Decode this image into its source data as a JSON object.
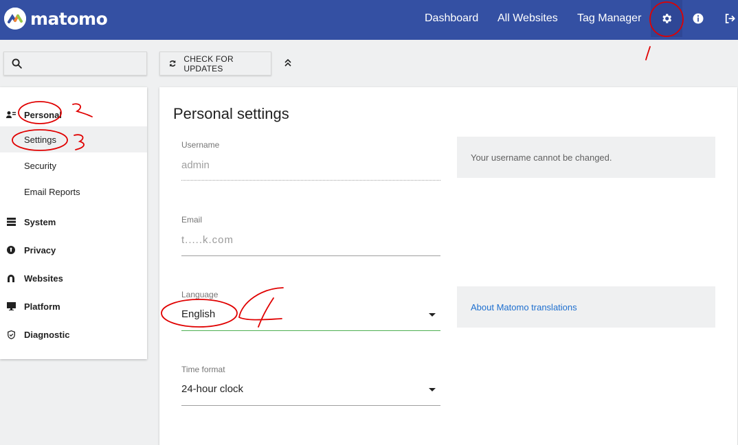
{
  "brand": {
    "name": "matomo"
  },
  "topnav": {
    "dashboard": "Dashboard",
    "all_websites": "All Websites",
    "tag_manager": "Tag Manager",
    "icons": [
      "gear-icon",
      "info-icon",
      "logout-icon"
    ]
  },
  "toolbar": {
    "search_placeholder": "",
    "check_updates": "CHECK FOR UPDATES"
  },
  "sidebar": {
    "personal": "Personal",
    "personal_items": [
      "Settings",
      "Security",
      "Email Reports"
    ],
    "system": "System",
    "privacy": "Privacy",
    "websites": "Websites",
    "platform": "Platform",
    "diagnostic": "Diagnostic",
    "active_item": "Settings"
  },
  "main": {
    "title": "Personal settings",
    "username": {
      "label": "Username",
      "value": "admin",
      "help": "Your username cannot be changed."
    },
    "email": {
      "label": "Email",
      "value": "t.....k.com"
    },
    "language": {
      "label": "Language",
      "value": "English",
      "help_link": "About Matomo translations"
    },
    "time_format": {
      "label": "Time format",
      "value": "24-hour clock"
    }
  },
  "annotations": [
    "1",
    "2",
    "3",
    "4"
  ],
  "colors": {
    "topbar": "#3450a3",
    "background": "#eff0f1",
    "link": "#1e6fcf",
    "active_underline": "#4caf50",
    "annotation": "#e00000"
  }
}
